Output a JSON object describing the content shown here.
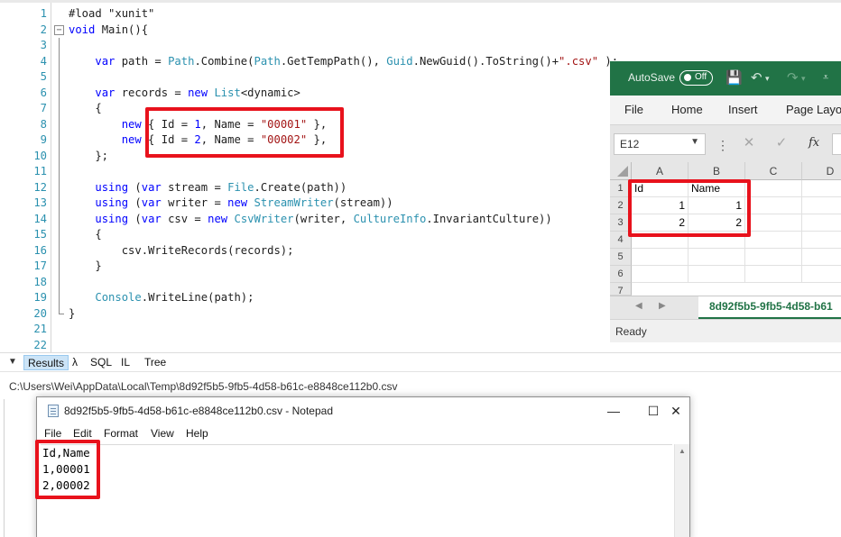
{
  "code_lines": [
    {
      "num": "1",
      "tokens": [
        {
          "t": "#load \"xunit\"",
          "c": "pl"
        }
      ]
    },
    {
      "num": "2",
      "tokens": [
        {
          "t": "void",
          "c": "kw"
        },
        {
          "t": " Main(){",
          "c": "pl"
        }
      ]
    },
    {
      "num": "3",
      "tokens": []
    },
    {
      "num": "4",
      "tokens": [
        {
          "t": "    ",
          "c": "pl"
        },
        {
          "t": "var",
          "c": "kw"
        },
        {
          "t": " path = ",
          "c": "pl"
        },
        {
          "t": "Path",
          "c": "ty"
        },
        {
          "t": ".Combine(",
          "c": "pl"
        },
        {
          "t": "Path",
          "c": "ty"
        },
        {
          "t": ".GetTempPath(), ",
          "c": "pl"
        },
        {
          "t": "Guid",
          "c": "ty"
        },
        {
          "t": ".NewGuid().ToString()+",
          "c": "pl"
        },
        {
          "t": "\".csv\"",
          "c": "st"
        },
        {
          "t": " );",
          "c": "pl"
        }
      ]
    },
    {
      "num": "5",
      "tokens": []
    },
    {
      "num": "6",
      "tokens": [
        {
          "t": "    ",
          "c": "pl"
        },
        {
          "t": "var",
          "c": "kw"
        },
        {
          "t": " records = ",
          "c": "pl"
        },
        {
          "t": "new",
          "c": "kw"
        },
        {
          "t": " ",
          "c": "pl"
        },
        {
          "t": "List",
          "c": "ty"
        },
        {
          "t": "<dynamic>",
          "c": "pl"
        }
      ]
    },
    {
      "num": "7",
      "tokens": [
        {
          "t": "    {",
          "c": "pl"
        }
      ]
    },
    {
      "num": "8",
      "tokens": [
        {
          "t": "        ",
          "c": "pl"
        },
        {
          "t": "new",
          "c": "kw"
        },
        {
          "t": " { Id = ",
          "c": "pl"
        },
        {
          "t": "1",
          "c": "nm"
        },
        {
          "t": ", Name = ",
          "c": "pl"
        },
        {
          "t": "\"00001\"",
          "c": "st"
        },
        {
          "t": " },",
          "c": "pl"
        }
      ]
    },
    {
      "num": "9",
      "tokens": [
        {
          "t": "        ",
          "c": "pl"
        },
        {
          "t": "new",
          "c": "kw"
        },
        {
          "t": " { Id = ",
          "c": "pl"
        },
        {
          "t": "2",
          "c": "nm"
        },
        {
          "t": ", Name = ",
          "c": "pl"
        },
        {
          "t": "\"00002\"",
          "c": "st"
        },
        {
          "t": " },",
          "c": "pl"
        }
      ]
    },
    {
      "num": "10",
      "tokens": [
        {
          "t": "    };",
          "c": "pl"
        }
      ]
    },
    {
      "num": "11",
      "tokens": []
    },
    {
      "num": "12",
      "tokens": [
        {
          "t": "    ",
          "c": "pl"
        },
        {
          "t": "using",
          "c": "kw"
        },
        {
          "t": " (",
          "c": "pl"
        },
        {
          "t": "var",
          "c": "kw"
        },
        {
          "t": " stream = ",
          "c": "pl"
        },
        {
          "t": "File",
          "c": "ty"
        },
        {
          "t": ".Create(path))",
          "c": "pl"
        }
      ]
    },
    {
      "num": "13",
      "tokens": [
        {
          "t": "    ",
          "c": "pl"
        },
        {
          "t": "using",
          "c": "kw"
        },
        {
          "t": " (",
          "c": "pl"
        },
        {
          "t": "var",
          "c": "kw"
        },
        {
          "t": " writer = ",
          "c": "pl"
        },
        {
          "t": "new",
          "c": "kw"
        },
        {
          "t": " ",
          "c": "pl"
        },
        {
          "t": "StreamWriter",
          "c": "ty"
        },
        {
          "t": "(stream))",
          "c": "pl"
        }
      ]
    },
    {
      "num": "14",
      "tokens": [
        {
          "t": "    ",
          "c": "pl"
        },
        {
          "t": "using",
          "c": "kw"
        },
        {
          "t": " (",
          "c": "pl"
        },
        {
          "t": "var",
          "c": "kw"
        },
        {
          "t": " csv = ",
          "c": "pl"
        },
        {
          "t": "new",
          "c": "kw"
        },
        {
          "t": " ",
          "c": "pl"
        },
        {
          "t": "CsvWriter",
          "c": "ty"
        },
        {
          "t": "(writer, ",
          "c": "pl"
        },
        {
          "t": "CultureInfo",
          "c": "ty"
        },
        {
          "t": ".InvariantCulture))",
          "c": "pl"
        }
      ]
    },
    {
      "num": "15",
      "tokens": [
        {
          "t": "    {",
          "c": "pl"
        }
      ]
    },
    {
      "num": "16",
      "tokens": [
        {
          "t": "        csv.WriteRecords(records);",
          "c": "pl"
        }
      ]
    },
    {
      "num": "17",
      "tokens": [
        {
          "t": "    }",
          "c": "pl"
        }
      ]
    },
    {
      "num": "18",
      "tokens": []
    },
    {
      "num": "19",
      "tokens": [
        {
          "t": "    ",
          "c": "pl"
        },
        {
          "t": "Console",
          "c": "ty"
        },
        {
          "t": ".WriteLine(path);",
          "c": "pl"
        }
      ]
    },
    {
      "num": "20",
      "tokens": [
        {
          "t": "}",
          "c": "pl"
        }
      ]
    },
    {
      "num": "21",
      "tokens": []
    },
    {
      "num": "22",
      "tokens": []
    }
  ],
  "excel": {
    "autosave_label": "AutoSave",
    "autosave_state": "Off",
    "ribbon_tabs": [
      "File",
      "Home",
      "Insert",
      "Page Layo"
    ],
    "name_box": "E12",
    "columns": [
      "A",
      "B",
      "C",
      "D"
    ],
    "rows": [
      "1",
      "2",
      "3",
      "4",
      "5",
      "6",
      "7"
    ],
    "cells": [
      [
        "Id",
        "Name"
      ],
      [
        "1",
        "1"
      ],
      [
        "2",
        "2"
      ]
    ],
    "sheet_tab": "8d92f5b5-9fb5-4d58-b61",
    "status": "Ready",
    "brand_color": "#217346"
  },
  "results": {
    "tabs": [
      "Results",
      "λ",
      "SQL",
      "IL",
      "Tree"
    ],
    "active_tab": "Results",
    "output_path": "C:\\Users\\Wei\\AppData\\Local\\Temp\\8d92f5b5-9fb5-4d58-b61c-e8848ce112b0.csv"
  },
  "notepad": {
    "title": "8d92f5b5-9fb5-4d58-b61c-e8848ce112b0.csv - Notepad",
    "menu": [
      "File",
      "Edit",
      "Format",
      "View",
      "Help"
    ],
    "minimize": "—",
    "maximize": "☐",
    "close": "✕",
    "lines": [
      "Id,Name",
      "1,00001",
      "2,00002"
    ]
  },
  "highlight_color": "#e8121c"
}
